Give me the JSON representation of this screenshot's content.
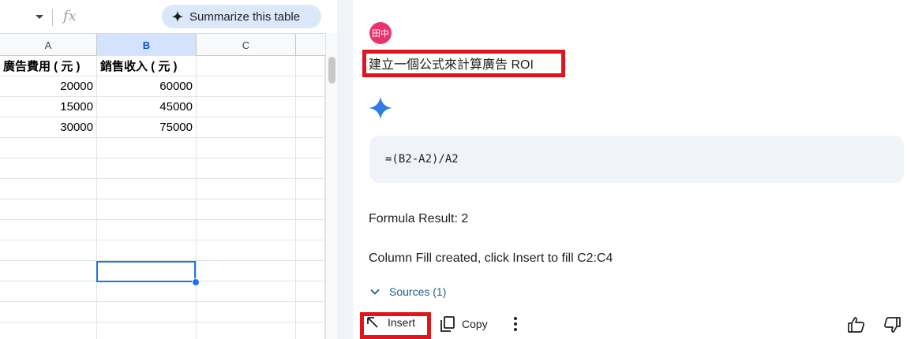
{
  "spreadsheet": {
    "fx_label": "fx",
    "summarize_chip": {
      "label": "Summarize this table",
      "icon": "sparkle-icon"
    },
    "columns": [
      "A",
      "B",
      "C"
    ],
    "selected_column": "B",
    "header_row": [
      "廣告費用 ( 元 )",
      "銷售收入 ( 元 )"
    ],
    "rows": [
      [
        "20000",
        "60000"
      ],
      [
        "15000",
        "45000"
      ],
      [
        "30000",
        "75000"
      ]
    ]
  },
  "gemini": {
    "user_avatar": "田中",
    "prompt": "建立一個公式來計算廣告 ROI",
    "code": "=(B2-A2)/A2",
    "result": "Formula Result: 2",
    "fill_message": "Column Fill created, click Insert to fill C2:C4",
    "sources_label": "Sources (1)",
    "actions": {
      "insert": "Insert",
      "copy": "Copy"
    },
    "colors": {
      "highlight": "#e0161e",
      "accent": "#1a73e8",
      "avatar": "#e8336d"
    }
  }
}
